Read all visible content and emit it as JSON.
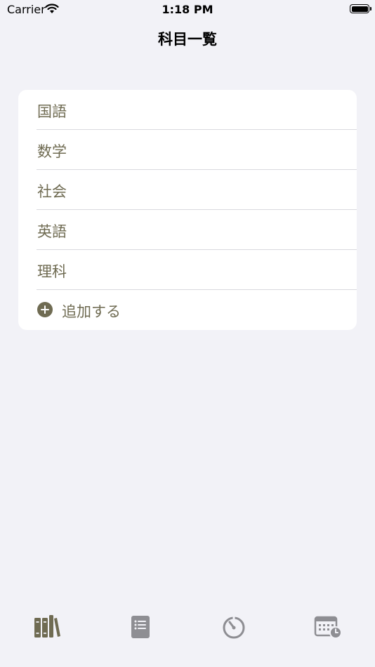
{
  "status_bar": {
    "carrier": "Carrier",
    "time": "1:18 PM"
  },
  "nav": {
    "title": "科目一覧"
  },
  "subjects": [
    {
      "label": "国語"
    },
    {
      "label": "数学"
    },
    {
      "label": "社会"
    },
    {
      "label": "英語"
    },
    {
      "label": "理科"
    }
  ],
  "add_row": {
    "label": "追加する",
    "icon": "plus-circle-icon"
  },
  "tabs": [
    {
      "icon": "books-icon",
      "selected": true
    },
    {
      "icon": "notebook-list-icon",
      "selected": false
    },
    {
      "icon": "timer-icon",
      "selected": false
    },
    {
      "icon": "calendar-clock-icon",
      "selected": false
    }
  ],
  "colors": {
    "accent": "#6f6b52",
    "inactive_tab": "#8e8e93",
    "background": "#f2f2f7",
    "card": "#ffffff"
  }
}
